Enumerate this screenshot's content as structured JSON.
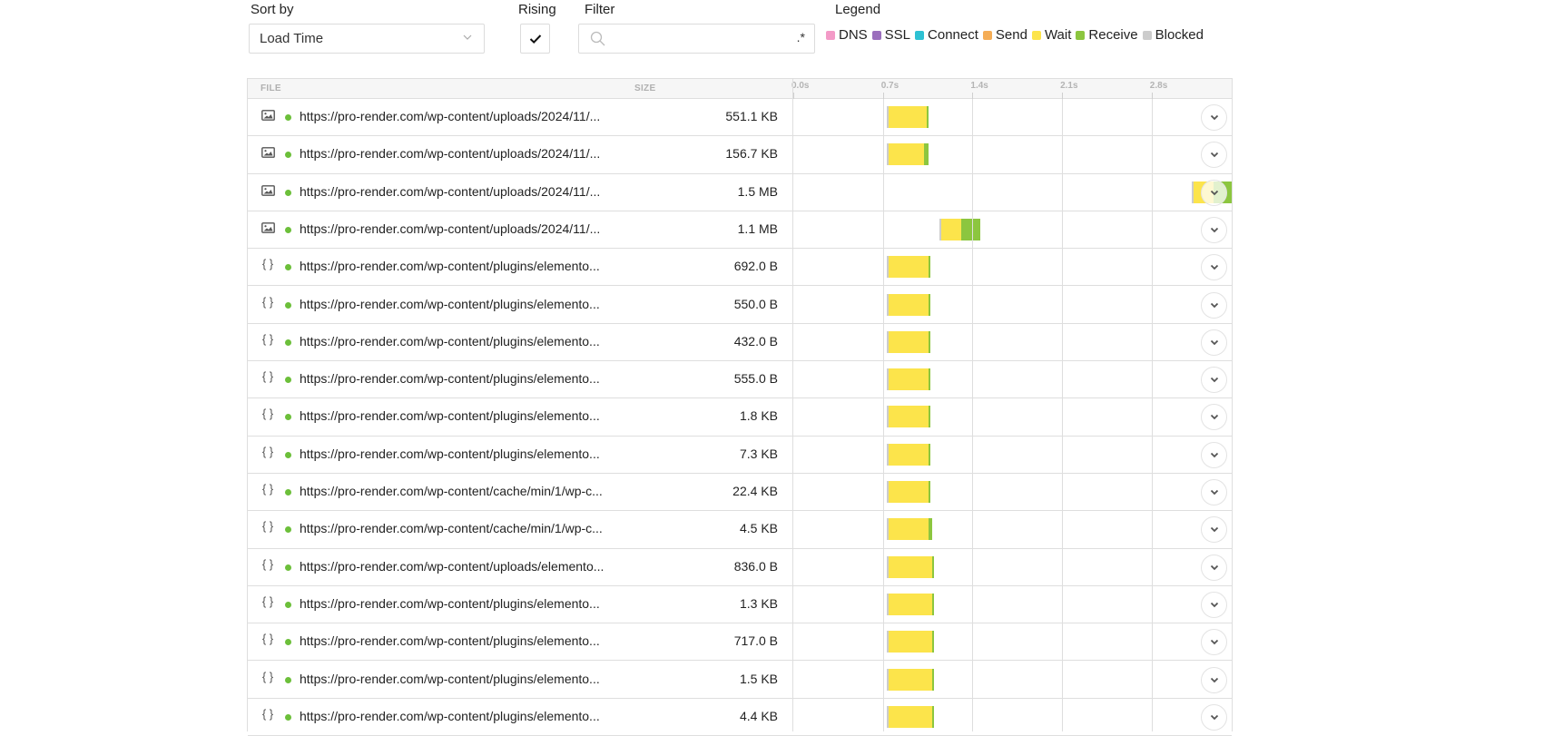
{
  "controls": {
    "sort_label": "Sort by",
    "sort_value": "Load Time",
    "rising_label": "Rising",
    "rising_checked": true,
    "filter_label": "Filter",
    "filter_value": "",
    "filter_placeholder": "",
    "filter_regex_label": ".*",
    "legend_label": "Legend"
  },
  "legend": [
    {
      "name": "DNS",
      "color": "#f39ac7"
    },
    {
      "name": "SSL",
      "color": "#9b6fbd"
    },
    {
      "name": "Connect",
      "color": "#2ec1d3"
    },
    {
      "name": "Send",
      "color": "#f5ad56"
    },
    {
      "name": "Wait",
      "color": "#fce44b"
    },
    {
      "name": "Receive",
      "color": "#8cc63f"
    },
    {
      "name": "Blocked",
      "color": "#cccccc"
    }
  ],
  "table": {
    "headers": {
      "file": "FILE",
      "size": "SIZE"
    },
    "axis": {
      "ticks": [
        "0.0s",
        "0.7s",
        "1.4s",
        "2.1s",
        "2.8s"
      ],
      "tick_values": [
        0,
        0.7,
        1.4,
        2.1,
        2.8
      ],
      "max_seconds": 3.42
    },
    "rows": [
      {
        "type": "image",
        "url": "https://pro-render.com/wp-content/uploads/2024/11/...",
        "size": "551.1 KB",
        "status": "ok",
        "timing": {
          "start": 0.73,
          "blocked": 0.01,
          "wait": 0.3,
          "receive": 0.01
        }
      },
      {
        "type": "image",
        "url": "https://pro-render.com/wp-content/uploads/2024/11/...",
        "size": "156.7 KB",
        "status": "ok",
        "timing": {
          "start": 0.73,
          "blocked": 0.01,
          "wait": 0.28,
          "receive": 0.03
        }
      },
      {
        "type": "image",
        "url": "https://pro-render.com/wp-content/uploads/2024/11/...",
        "size": "1.5 MB",
        "status": "ok",
        "timing": {
          "start": 3.11,
          "blocked": 0.01,
          "wait": 0.16,
          "receive": 0.14
        }
      },
      {
        "type": "image",
        "url": "https://pro-render.com/wp-content/uploads/2024/11/...",
        "size": "1.1 MB",
        "status": "ok",
        "timing": {
          "start": 1.14,
          "blocked": 0.01,
          "wait": 0.16,
          "receive": 0.15
        }
      },
      {
        "type": "code",
        "url": "https://pro-render.com/wp-content/plugins/elemento...",
        "size": "692.0 B",
        "status": "ok",
        "timing": {
          "start": 0.73,
          "blocked": 0.01,
          "wait": 0.31,
          "receive": 0.01
        }
      },
      {
        "type": "code",
        "url": "https://pro-render.com/wp-content/plugins/elemento...",
        "size": "550.0 B",
        "status": "ok",
        "timing": {
          "start": 0.73,
          "blocked": 0.01,
          "wait": 0.31,
          "receive": 0.01
        }
      },
      {
        "type": "code",
        "url": "https://pro-render.com/wp-content/plugins/elemento...",
        "size": "432.0 B",
        "status": "ok",
        "timing": {
          "start": 0.73,
          "blocked": 0.01,
          "wait": 0.31,
          "receive": 0.01
        }
      },
      {
        "type": "code",
        "url": "https://pro-render.com/wp-content/plugins/elemento...",
        "size": "555.0 B",
        "status": "ok",
        "timing": {
          "start": 0.73,
          "blocked": 0.01,
          "wait": 0.31,
          "receive": 0.01
        }
      },
      {
        "type": "code",
        "url": "https://pro-render.com/wp-content/plugins/elemento...",
        "size": "1.8 KB",
        "status": "ok",
        "timing": {
          "start": 0.73,
          "blocked": 0.01,
          "wait": 0.31,
          "receive": 0.01
        }
      },
      {
        "type": "code",
        "url": "https://pro-render.com/wp-content/plugins/elemento...",
        "size": "7.3 KB",
        "status": "ok",
        "timing": {
          "start": 0.73,
          "blocked": 0.01,
          "wait": 0.31,
          "receive": 0.01
        }
      },
      {
        "type": "code",
        "url": "https://pro-render.com/wp-content/cache/min/1/wp-c...",
        "size": "22.4 KB",
        "status": "ok",
        "timing": {
          "start": 0.73,
          "blocked": 0.01,
          "wait": 0.31,
          "receive": 0.01
        }
      },
      {
        "type": "code",
        "url": "https://pro-render.com/wp-content/cache/min/1/wp-c...",
        "size": "4.5 KB",
        "status": "ok",
        "timing": {
          "start": 0.73,
          "blocked": 0.01,
          "wait": 0.31,
          "receive": 0.03
        }
      },
      {
        "type": "code",
        "url": "https://pro-render.com/wp-content/uploads/elemento...",
        "size": "836.0 B",
        "status": "ok",
        "timing": {
          "start": 0.73,
          "blocked": 0.01,
          "wait": 0.34,
          "receive": 0.01
        }
      },
      {
        "type": "code",
        "url": "https://pro-render.com/wp-content/plugins/elemento...",
        "size": "1.3 KB",
        "status": "ok",
        "timing": {
          "start": 0.73,
          "blocked": 0.01,
          "wait": 0.34,
          "receive": 0.01
        }
      },
      {
        "type": "code",
        "url": "https://pro-render.com/wp-content/plugins/elemento...",
        "size": "717.0 B",
        "status": "ok",
        "timing": {
          "start": 0.73,
          "blocked": 0.01,
          "wait": 0.34,
          "receive": 0.01
        }
      },
      {
        "type": "code",
        "url": "https://pro-render.com/wp-content/plugins/elemento...",
        "size": "1.5 KB",
        "status": "ok",
        "timing": {
          "start": 0.73,
          "blocked": 0.01,
          "wait": 0.34,
          "receive": 0.01
        }
      },
      {
        "type": "code",
        "url": "https://pro-render.com/wp-content/plugins/elemento...",
        "size": "4.4 KB",
        "status": "ok",
        "timing": {
          "start": 0.73,
          "blocked": 0.01,
          "wait": 0.34,
          "receive": 0.01
        }
      }
    ]
  }
}
